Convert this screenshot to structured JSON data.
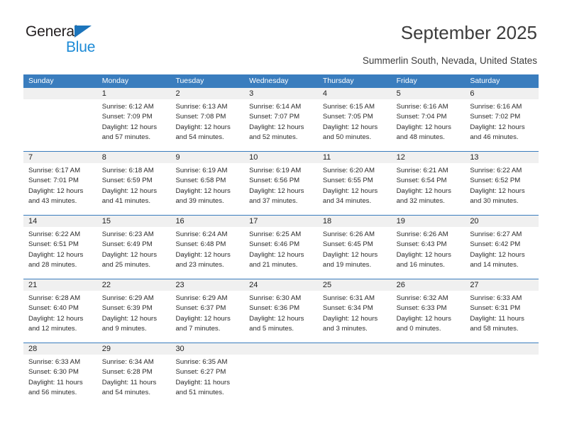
{
  "brand": {
    "name_dark": "General",
    "name_blue": "Blue",
    "accent_blue": "#1c8ad6",
    "triangle_blue": "#1c74bb"
  },
  "header": {
    "title": "September 2025",
    "subtitle": "Summerlin South, Nevada, United States",
    "header_row_bg": "#3a7dbe",
    "daynum_band_bg": "#f0f0f0"
  },
  "weekdays": [
    "Sunday",
    "Monday",
    "Tuesday",
    "Wednesday",
    "Thursday",
    "Friday",
    "Saturday"
  ],
  "weeks": [
    {
      "days": [
        {
          "num": "",
          "lines": [
            "",
            "",
            "",
            ""
          ],
          "empty": true
        },
        {
          "num": "1",
          "lines": [
            "Sunrise: 6:12 AM",
            "Sunset: 7:09 PM",
            "Daylight: 12 hours",
            "and 57 minutes."
          ]
        },
        {
          "num": "2",
          "lines": [
            "Sunrise: 6:13 AM",
            "Sunset: 7:08 PM",
            "Daylight: 12 hours",
            "and 54 minutes."
          ]
        },
        {
          "num": "3",
          "lines": [
            "Sunrise: 6:14 AM",
            "Sunset: 7:07 PM",
            "Daylight: 12 hours",
            "and 52 minutes."
          ]
        },
        {
          "num": "4",
          "lines": [
            "Sunrise: 6:15 AM",
            "Sunset: 7:05 PM",
            "Daylight: 12 hours",
            "and 50 minutes."
          ]
        },
        {
          "num": "5",
          "lines": [
            "Sunrise: 6:16 AM",
            "Sunset: 7:04 PM",
            "Daylight: 12 hours",
            "and 48 minutes."
          ]
        },
        {
          "num": "6",
          "lines": [
            "Sunrise: 6:16 AM",
            "Sunset: 7:02 PM",
            "Daylight: 12 hours",
            "and 46 minutes."
          ]
        }
      ]
    },
    {
      "days": [
        {
          "num": "7",
          "lines": [
            "Sunrise: 6:17 AM",
            "Sunset: 7:01 PM",
            "Daylight: 12 hours",
            "and 43 minutes."
          ]
        },
        {
          "num": "8",
          "lines": [
            "Sunrise: 6:18 AM",
            "Sunset: 6:59 PM",
            "Daylight: 12 hours",
            "and 41 minutes."
          ]
        },
        {
          "num": "9",
          "lines": [
            "Sunrise: 6:19 AM",
            "Sunset: 6:58 PM",
            "Daylight: 12 hours",
            "and 39 minutes."
          ]
        },
        {
          "num": "10",
          "lines": [
            "Sunrise: 6:19 AM",
            "Sunset: 6:56 PM",
            "Daylight: 12 hours",
            "and 37 minutes."
          ]
        },
        {
          "num": "11",
          "lines": [
            "Sunrise: 6:20 AM",
            "Sunset: 6:55 PM",
            "Daylight: 12 hours",
            "and 34 minutes."
          ]
        },
        {
          "num": "12",
          "lines": [
            "Sunrise: 6:21 AM",
            "Sunset: 6:54 PM",
            "Daylight: 12 hours",
            "and 32 minutes."
          ]
        },
        {
          "num": "13",
          "lines": [
            "Sunrise: 6:22 AM",
            "Sunset: 6:52 PM",
            "Daylight: 12 hours",
            "and 30 minutes."
          ]
        }
      ]
    },
    {
      "days": [
        {
          "num": "14",
          "lines": [
            "Sunrise: 6:22 AM",
            "Sunset: 6:51 PM",
            "Daylight: 12 hours",
            "and 28 minutes."
          ]
        },
        {
          "num": "15",
          "lines": [
            "Sunrise: 6:23 AM",
            "Sunset: 6:49 PM",
            "Daylight: 12 hours",
            "and 25 minutes."
          ]
        },
        {
          "num": "16",
          "lines": [
            "Sunrise: 6:24 AM",
            "Sunset: 6:48 PM",
            "Daylight: 12 hours",
            "and 23 minutes."
          ]
        },
        {
          "num": "17",
          "lines": [
            "Sunrise: 6:25 AM",
            "Sunset: 6:46 PM",
            "Daylight: 12 hours",
            "and 21 minutes."
          ]
        },
        {
          "num": "18",
          "lines": [
            "Sunrise: 6:26 AM",
            "Sunset: 6:45 PM",
            "Daylight: 12 hours",
            "and 19 minutes."
          ]
        },
        {
          "num": "19",
          "lines": [
            "Sunrise: 6:26 AM",
            "Sunset: 6:43 PM",
            "Daylight: 12 hours",
            "and 16 minutes."
          ]
        },
        {
          "num": "20",
          "lines": [
            "Sunrise: 6:27 AM",
            "Sunset: 6:42 PM",
            "Daylight: 12 hours",
            "and 14 minutes."
          ]
        }
      ]
    },
    {
      "days": [
        {
          "num": "21",
          "lines": [
            "Sunrise: 6:28 AM",
            "Sunset: 6:40 PM",
            "Daylight: 12 hours",
            "and 12 minutes."
          ]
        },
        {
          "num": "22",
          "lines": [
            "Sunrise: 6:29 AM",
            "Sunset: 6:39 PM",
            "Daylight: 12 hours",
            "and 9 minutes."
          ]
        },
        {
          "num": "23",
          "lines": [
            "Sunrise: 6:29 AM",
            "Sunset: 6:37 PM",
            "Daylight: 12 hours",
            "and 7 minutes."
          ]
        },
        {
          "num": "24",
          "lines": [
            "Sunrise: 6:30 AM",
            "Sunset: 6:36 PM",
            "Daylight: 12 hours",
            "and 5 minutes."
          ]
        },
        {
          "num": "25",
          "lines": [
            "Sunrise: 6:31 AM",
            "Sunset: 6:34 PM",
            "Daylight: 12 hours",
            "and 3 minutes."
          ]
        },
        {
          "num": "26",
          "lines": [
            "Sunrise: 6:32 AM",
            "Sunset: 6:33 PM",
            "Daylight: 12 hours",
            "and 0 minutes."
          ]
        },
        {
          "num": "27",
          "lines": [
            "Sunrise: 6:33 AM",
            "Sunset: 6:31 PM",
            "Daylight: 11 hours",
            "and 58 minutes."
          ]
        }
      ]
    },
    {
      "days": [
        {
          "num": "28",
          "lines": [
            "Sunrise: 6:33 AM",
            "Sunset: 6:30 PM",
            "Daylight: 11 hours",
            "and 56 minutes."
          ]
        },
        {
          "num": "29",
          "lines": [
            "Sunrise: 6:34 AM",
            "Sunset: 6:28 PM",
            "Daylight: 11 hours",
            "and 54 minutes."
          ]
        },
        {
          "num": "30",
          "lines": [
            "Sunrise: 6:35 AM",
            "Sunset: 6:27 PM",
            "Daylight: 11 hours",
            "and 51 minutes."
          ]
        },
        {
          "num": "",
          "lines": [
            "",
            "",
            "",
            ""
          ],
          "empty": true
        },
        {
          "num": "",
          "lines": [
            "",
            "",
            "",
            ""
          ],
          "empty": true
        },
        {
          "num": "",
          "lines": [
            "",
            "",
            "",
            ""
          ],
          "empty": true
        },
        {
          "num": "",
          "lines": [
            "",
            "",
            "",
            ""
          ],
          "empty": true
        }
      ]
    }
  ]
}
